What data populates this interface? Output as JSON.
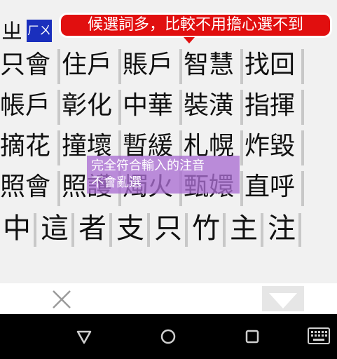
{
  "ime": {
    "composing_char": "ㄓ",
    "zhuyin_input": "ㄏㄨ",
    "tip_red": "候選詞多，比較不用擔心選不到",
    "tip_purple": "完全符合輸入的注音\n不會亂選"
  },
  "candidates": {
    "rows": [
      [
        "只會",
        "住戶",
        "賬戶",
        "智慧",
        "找回"
      ],
      [
        "帳戶",
        "彰化",
        "中華",
        "裝潢",
        "指揮"
      ],
      [
        "摘花",
        "撞壞",
        "暫緩",
        "札幌",
        "炸毀"
      ],
      [
        "照會",
        "照護",
        "燭火",
        "甄嬛",
        "直呼"
      ]
    ],
    "singles": [
      "中",
      "這",
      "者",
      "支",
      "只",
      "竹",
      "主",
      "注"
    ]
  },
  "icons": {
    "close": "close-icon",
    "collapse": "chevron-down-icon",
    "nav_back": "nav-back-icon",
    "nav_home": "nav-home-icon",
    "nav_recent": "nav-recent-icon",
    "nav_keyboard": "keyboard-icon"
  },
  "colors": {
    "tip_red": "#e10f0f",
    "zhuyin_box": "#1a2fbd",
    "tip_purple": "#aa6ed2"
  }
}
